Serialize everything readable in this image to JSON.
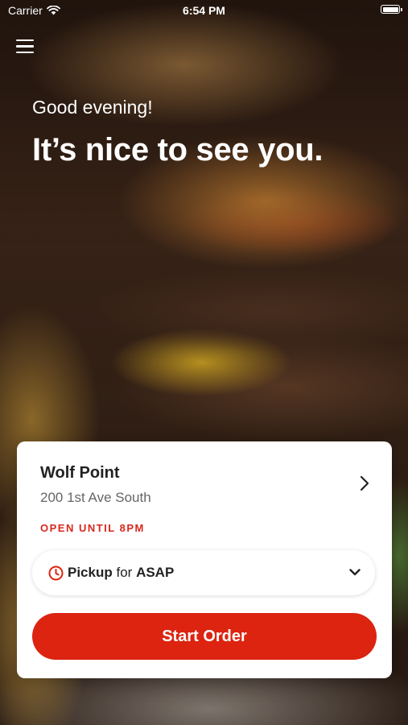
{
  "status_bar": {
    "carrier": "Carrier",
    "time": "6:54 PM"
  },
  "hero": {
    "greeting": "Good evening!",
    "headline": "It’s nice to see you."
  },
  "location_card": {
    "name": "Wolf Point",
    "address": "200 1st Ave South",
    "hours": "OPEN UNTIL 8PM",
    "order_type": "Pickup",
    "connector": "for",
    "order_time": "ASAP",
    "start_button_label": "Start Order"
  },
  "colors": {
    "accent": "#dc2410",
    "hours_text": "#d7281c"
  },
  "icons": {
    "menu": "hamburger-icon",
    "wifi": "wifi-icon",
    "battery": "battery-icon",
    "chevron_right": "chevron-right-icon",
    "clock": "clock-icon",
    "chevron_down": "chevron-down-icon"
  }
}
